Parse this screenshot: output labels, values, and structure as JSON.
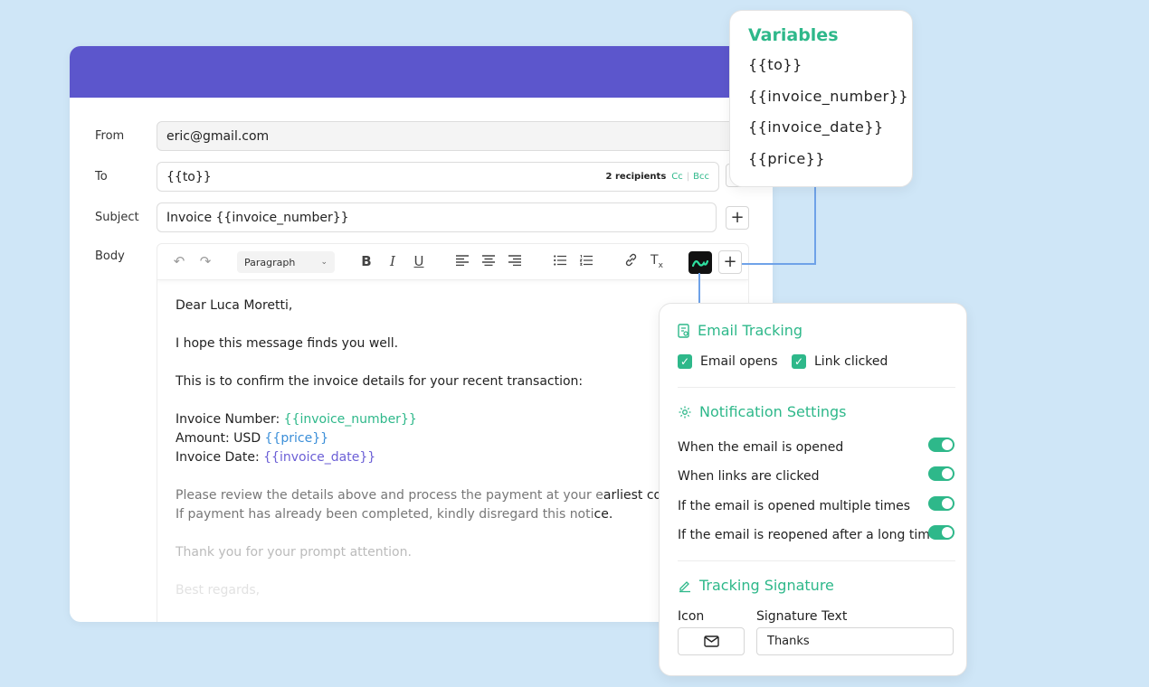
{
  "compose": {
    "from_label": "From",
    "from_value": "eric@gmail.com",
    "to_label": "To",
    "to_value": "{{to}}",
    "recipients": "2 recipients",
    "cc": "Cc",
    "bcc": "Bcc",
    "subject_label": "Subject",
    "subject_value": "Invoice {{invoice_number}}",
    "body_label": "Body",
    "plus": "+",
    "toolbar": {
      "paragraph": "Paragraph"
    },
    "body": {
      "greeting": "Dear Luca Moretti,",
      "line1": "I hope this message finds you well.",
      "line2": "This is to confirm the invoice details for your recent transaction:",
      "inv_num_label": "Invoice Number: ",
      "inv_num_var": "{{invoice_number}}",
      "amount_label": "Amount: USD ",
      "amount_var": "{{price}}",
      "inv_date_label": "Invoice Date: ",
      "inv_date_var": "{{invoice_date}}",
      "review_a": "Please review the details above and process the payment at your e",
      "review_b": "arliest con",
      "paid_a": "If payment has already been completed, kindly disregard this noti",
      "paid_b": "ce.",
      "thanks": "Thank you for your prompt attention.",
      "regards": "Best regards,"
    }
  },
  "variables": {
    "title": "Variables",
    "items": [
      "{{to}}",
      "{{invoice_number}}",
      "{{invoice_date}}",
      "{{price}}"
    ]
  },
  "tracking": {
    "email_tracking_title": "Email Tracking",
    "email_opens": "Email opens",
    "link_clicked": "Link clicked",
    "notification_title": "Notification Settings",
    "settings": [
      "When the email is opened",
      "When links are clicked",
      "If the email is opened multiple times",
      "If the email is reopened after a long time"
    ],
    "signature_title": "Tracking Signature",
    "icon_label": "Icon",
    "signature_text_label": "Signature Text",
    "signature_text_value": "Thanks"
  },
  "colors": {
    "header": "#5c56cc",
    "accent_green": "#2eb88a",
    "connector": "#6fa2e8",
    "background": "#cfe6f7"
  }
}
